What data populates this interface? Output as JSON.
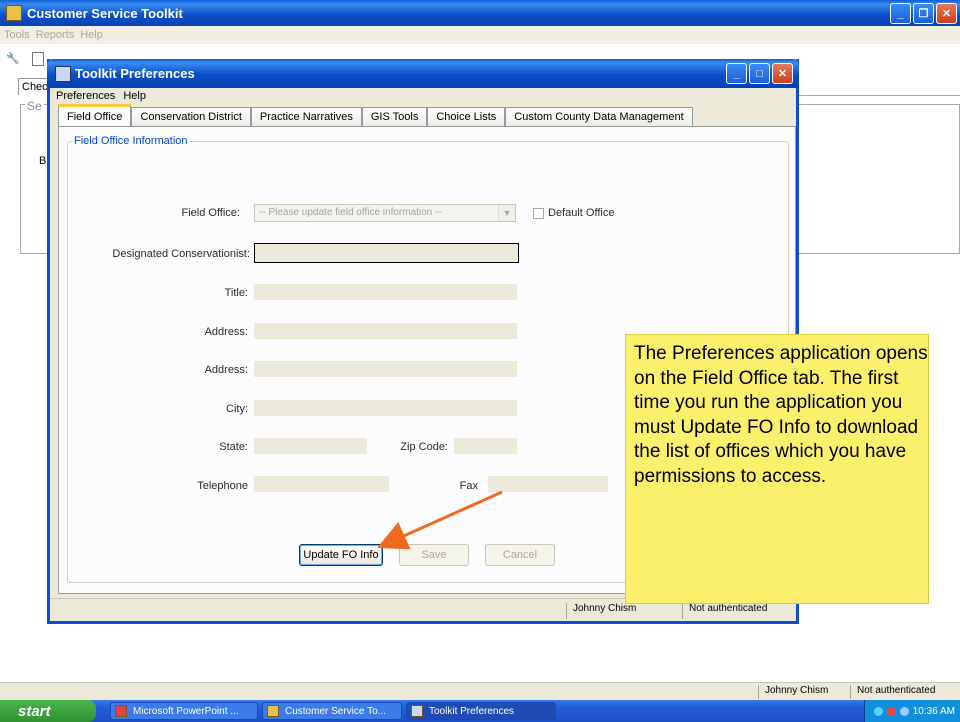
{
  "app": {
    "title": "Customer Service Toolkit",
    "menu": [
      "Tools",
      "Reports",
      "Help"
    ],
    "behind_tab": "Check",
    "behind_group": "Se",
    "behind_text": "Bu",
    "status": {
      "user": "Johnny Chism",
      "auth": "Not authenticated"
    }
  },
  "dialog": {
    "title": "Toolkit Preferences",
    "menu": [
      "Preferences",
      "Help"
    ],
    "tabs": [
      "Field Office",
      "Conservation District",
      "Practice Narratives",
      "GIS Tools",
      "Choice Lists",
      "Custom County Data Management"
    ],
    "active_tab": "Field Office",
    "group_title": "Field Office Information",
    "form": {
      "field_office_label": "Field Office:",
      "field_office_value": "-- Please update field office information --",
      "default_office_label": "Default Office",
      "default_office_checked": false,
      "designated_label": "Designated Conservationist:",
      "title_label": "Title:",
      "address1_label": "Address:",
      "address2_label": "Address:",
      "city_label": "City:",
      "state_label": "State:",
      "zip_label": "Zip Code:",
      "telephone_label": "Telephone",
      "fax_label": "Fax"
    },
    "buttons": {
      "update": "Update FO Info",
      "save": "Save",
      "cancel": "Cancel"
    },
    "status": {
      "user": "Johnny Chism",
      "auth": "Not authenticated"
    }
  },
  "callout": {
    "text": "The Preferences application opens on the Field Office tab. The first time you run the application you must Update FO Info to download the list of offices which you have permissions to access."
  },
  "taskbar": {
    "start": "start",
    "tasks": [
      "Microsoft PowerPoint ...",
      "Customer Service To...",
      "Toolkit Preferences"
    ],
    "active_task": "Toolkit Preferences",
    "clock": "10:36 AM"
  },
  "colors": {
    "callout_bg": "#fbf06c",
    "arrow": "#ef6a1f",
    "titlebar": "#0a4fc8"
  }
}
